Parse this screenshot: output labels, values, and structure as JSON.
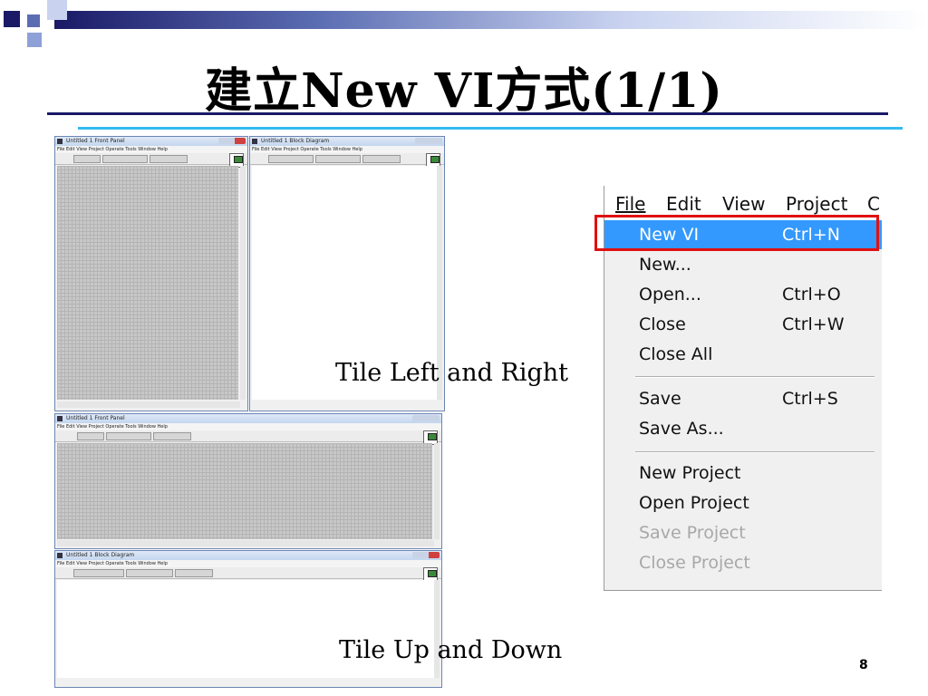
{
  "slide": {
    "title": "建立New VI方式(1/1)",
    "caption_left_right": "Tile Left and Right",
    "caption_up_down": "Tile Up and Down",
    "page_number": "8"
  },
  "thumbnails": {
    "front_panel_title": "Untitled 1 Front Panel",
    "block_diagram_title": "Untitled 1 Block Diagram",
    "menu_items": "File  Edit  View  Project  Operate  Tools  Window  Help",
    "font_label": "15pt Application Font"
  },
  "menu": {
    "bar": {
      "file": "File",
      "edit": "Edit",
      "view": "View",
      "project": "Project",
      "cut": "C"
    },
    "items": [
      {
        "label": "New VI",
        "shortcut": "Ctrl+N"
      },
      {
        "label": "New...",
        "shortcut": ""
      },
      {
        "label": "Open...",
        "shortcut": "Ctrl+O"
      },
      {
        "label": "Close",
        "shortcut": "Ctrl+W"
      },
      {
        "label": "Close All",
        "shortcut": ""
      },
      {
        "label": "Save",
        "shortcut": "Ctrl+S"
      },
      {
        "label": "Save As...",
        "shortcut": ""
      },
      {
        "label": "New Project",
        "shortcut": ""
      },
      {
        "label": "Open Project",
        "shortcut": ""
      },
      {
        "label": "Save Project",
        "shortcut": ""
      },
      {
        "label": "Close Project",
        "shortcut": ""
      }
    ]
  },
  "colors": {
    "highlight": "#3399ff",
    "red_frame": "#e01010",
    "title_rule": "#1a1a66",
    "accent_rule": "#33bbee"
  }
}
